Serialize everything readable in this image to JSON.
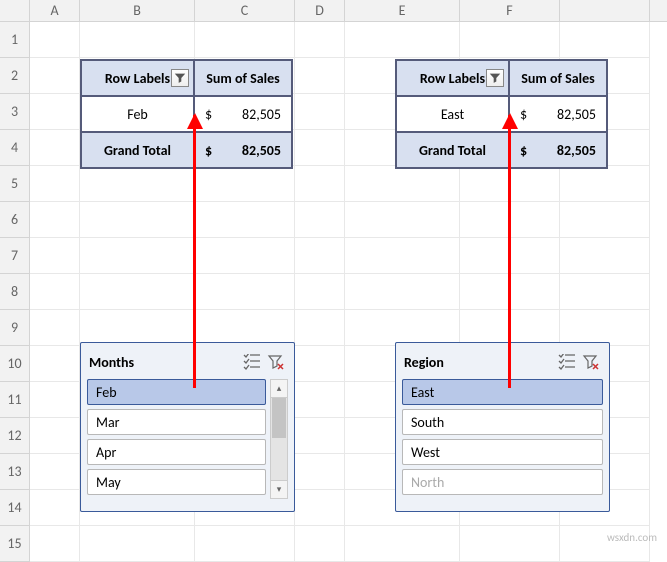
{
  "columns": [
    "A",
    "B",
    "C",
    "D",
    "E",
    "F"
  ],
  "rows": [
    "1",
    "2",
    "3",
    "4",
    "5",
    "6",
    "7",
    "8",
    "9",
    "10",
    "11",
    "12",
    "13",
    "14",
    "15"
  ],
  "pivot1": {
    "h_label": "Row Labels",
    "h_value": "Sum of Sales",
    "data_label": "Feb",
    "data_dollar": "$",
    "data_val": "82,505",
    "total_label": "Grand Total",
    "total_dollar": "$",
    "total_val": "82,505"
  },
  "pivot2": {
    "h_label": "Row Labels",
    "h_value": "Sum of Sales",
    "data_label": "East",
    "data_dollar": "$",
    "data_val": "82,505",
    "total_label": "Grand Total",
    "total_dollar": "$",
    "total_val": "82,505"
  },
  "slicer1": {
    "title": "Months",
    "items": [
      "Feb",
      "Mar",
      "Apr",
      "May"
    ],
    "selected": "Feb"
  },
  "slicer2": {
    "title": "Region",
    "items": [
      "East",
      "South",
      "West",
      "North"
    ],
    "selected": "East",
    "dimmed": "North"
  },
  "watermark": "wsxdn.com"
}
